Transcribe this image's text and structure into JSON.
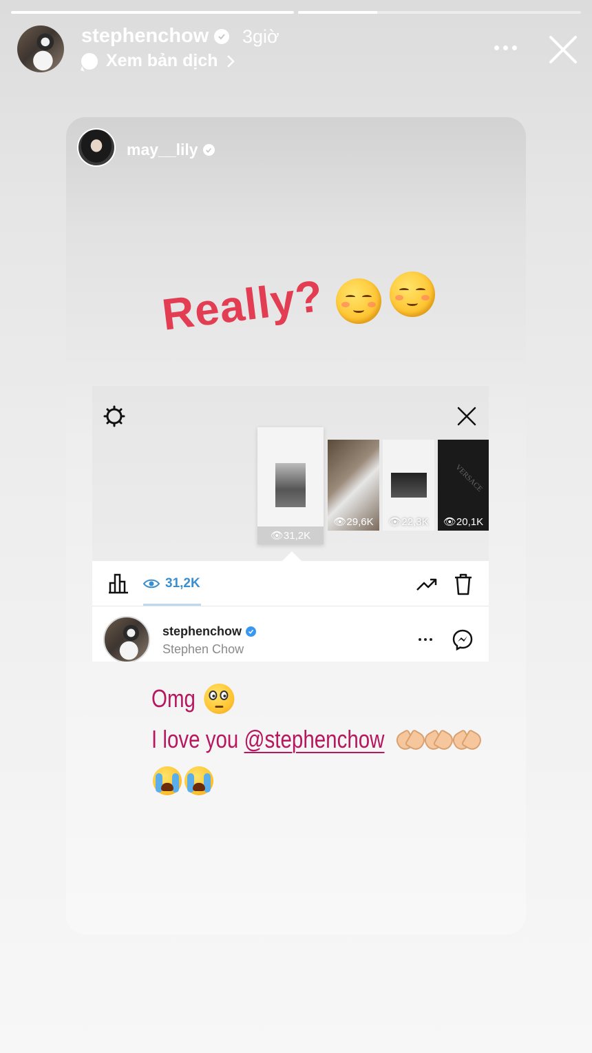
{
  "header": {
    "username": "stephenchow",
    "time": "3giờ",
    "translate_label": "Xem bản dịch",
    "progress": [
      1.0,
      0.28
    ]
  },
  "shared_story": {
    "username": "may__lily",
    "headline": "Really?",
    "screenshot": {
      "thumbnails": [
        {
          "views": "31,2K"
        },
        {
          "views": "29,6K"
        },
        {
          "views": "22,3K"
        },
        {
          "views": "20,1K"
        }
      ],
      "brand_text": "VERSACE",
      "views_count": "31,2K",
      "viewer": {
        "username": "stephenchow",
        "full_name": "Stephen Chow"
      }
    },
    "caption": {
      "line1": "Omg",
      "line2_prefix": "I love you",
      "mention": "@stephenchow"
    }
  },
  "icons": {
    "close": "close-icon",
    "more": "more-icon",
    "gear": "gear-icon",
    "bars": "bar-chart-icon",
    "eye": "eye-icon",
    "trend": "trending-up-icon",
    "trash": "trash-icon",
    "messenger": "messenger-icon"
  },
  "colors": {
    "headline": "#e23d52",
    "caption": "#b7175e",
    "views_blue": "#3a8fd0",
    "verified_blue": "#3897f0"
  }
}
